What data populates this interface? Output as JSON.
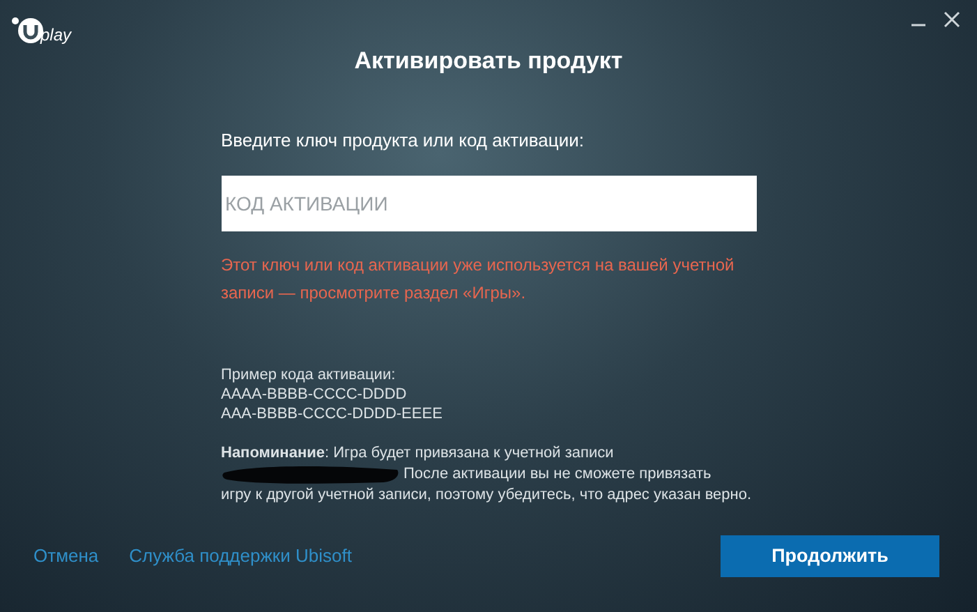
{
  "window": {
    "title": "Активировать продукт",
    "logo": "play"
  },
  "form": {
    "prompt": "Введите ключ продукта или код активации:",
    "placeholder": "КОД АКТИВАЦИИ",
    "error": "Этот ключ или код активации уже используется на вашей учетной записи — просмотрите раздел «Игры»."
  },
  "example": {
    "heading": "Пример кода активации:",
    "codes": [
      "AAAA-BBBB-CCCC-DDDD",
      "AAA-BBBB-CCCC-DDDD-EEEE"
    ]
  },
  "reminder": {
    "first_line": "**Напоминание**: Игра будет привязана к учетной записи",
    "second_line": "После активации вы не сможете привязать",
    "rest": "игру к другой учетной записи, поэтому убедитесь, что адрес указан верно."
  },
  "footer": {
    "links": [
      "Отмена",
      "Служба поддержки Ubisoft"
    ],
    "button": "Продолжить"
  }
}
